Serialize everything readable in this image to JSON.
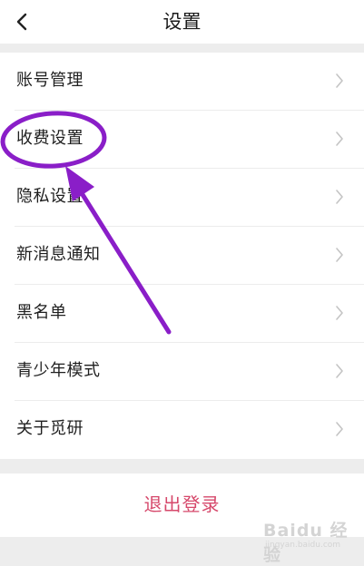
{
  "header": {
    "title": "设置",
    "back_icon": "chevron-left-icon"
  },
  "menu": {
    "items": [
      {
        "label": "账号管理"
      },
      {
        "label": "收费设置"
      },
      {
        "label": "隐私设置"
      },
      {
        "label": "新消息通知"
      },
      {
        "label": "黑名单"
      },
      {
        "label": "青少年模式"
      },
      {
        "label": "关于觅研"
      }
    ]
  },
  "logout": {
    "label": "退出登录",
    "color": "#d6486b"
  },
  "annotation": {
    "color": "#8a1ec8"
  },
  "watermark": {
    "main": "Baidu 经验",
    "sub": "jingyan.baidu.com"
  }
}
